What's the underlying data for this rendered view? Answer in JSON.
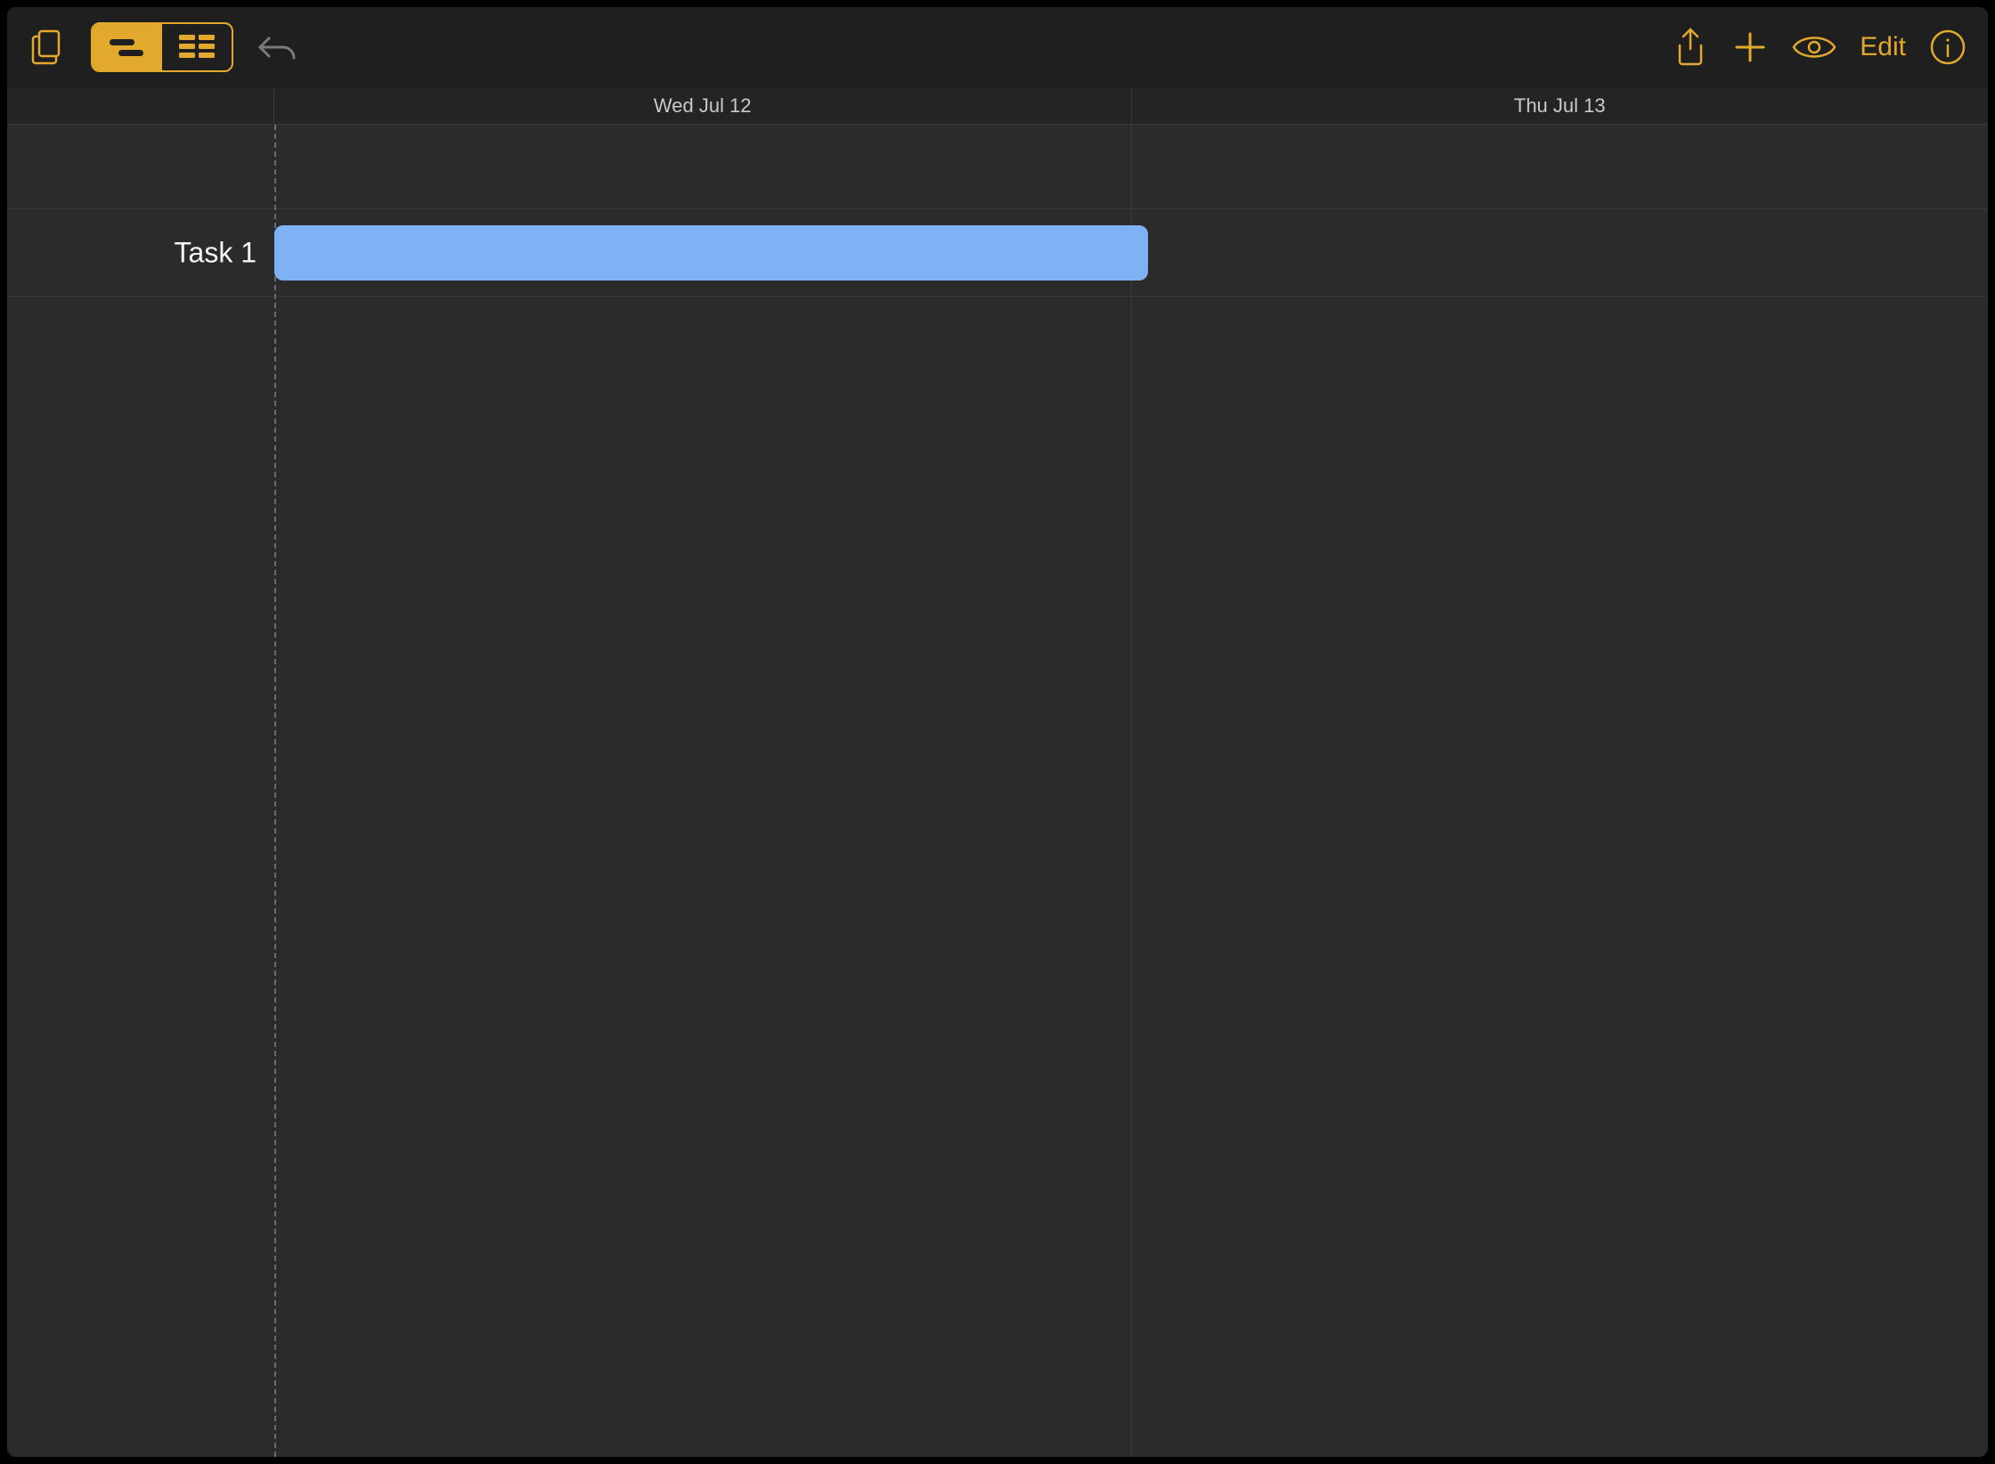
{
  "toolbar": {
    "edit_label": "Edit"
  },
  "dates": [
    "Wed Jul 12",
    "Thu Jul 13"
  ],
  "tasks": [
    {
      "label": "Task 1",
      "start_pct": 0,
      "width_pct": 51
    }
  ],
  "colors": {
    "accent": "#e3a92c",
    "task_bar": "#7fb2f5"
  }
}
